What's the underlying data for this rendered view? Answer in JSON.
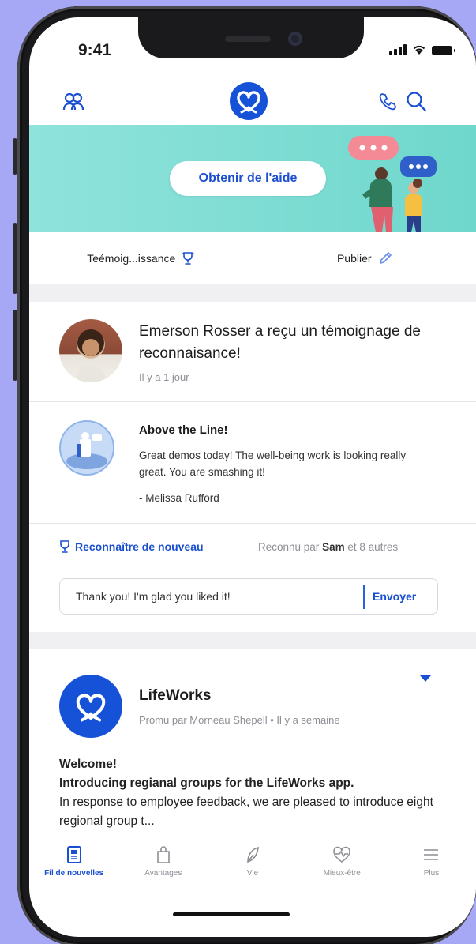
{
  "status": {
    "time": "9:41"
  },
  "banner": {
    "help_button": "Obtenir de l'aide"
  },
  "actions": {
    "left_label": "Teémoig...issance",
    "right_label": "Publier"
  },
  "recognition": {
    "title": "Emerson Rosser a reçu un témoignage de reconnaisance!",
    "time": "Il y a 1 jour",
    "award_title": "Above the Line!",
    "message": "Great demos today! The well-being work is looking really great. You are smashing it!",
    "signature": "- Melissa Rufford",
    "recognize_again": "Reconnaître de nouveau",
    "recognized_prefix": "Reconnu par ",
    "recognized_name": "Sam",
    "recognized_suffix": " et 8 autres",
    "reply_value": "Thank you! I'm glad you liked it!",
    "send_label": "Envoyer"
  },
  "post": {
    "brand": "LifeWorks",
    "meta": "Promu par Morneau Shepell • Il y a semaine",
    "headline": "Welcome!",
    "subhead": "Introducing regianal groups for the LifeWorks app.",
    "body": "In response to employee feedback, we are pleased to introduce eight regional group t..."
  },
  "tabs": [
    {
      "label": "Fil de nouvelles",
      "icon": "newsfeed-icon"
    },
    {
      "label": "Avantages",
      "icon": "shopping-bag-icon"
    },
    {
      "label": "Vie",
      "icon": "leaf-icon"
    },
    {
      "label": "Mieux-être",
      "icon": "heart-pulse-icon"
    },
    {
      "label": "Plus",
      "icon": "menu-icon"
    }
  ],
  "colors": {
    "accent": "#1a4fd1",
    "banner": "#7fdcd3",
    "background": "#a7a8f5"
  }
}
